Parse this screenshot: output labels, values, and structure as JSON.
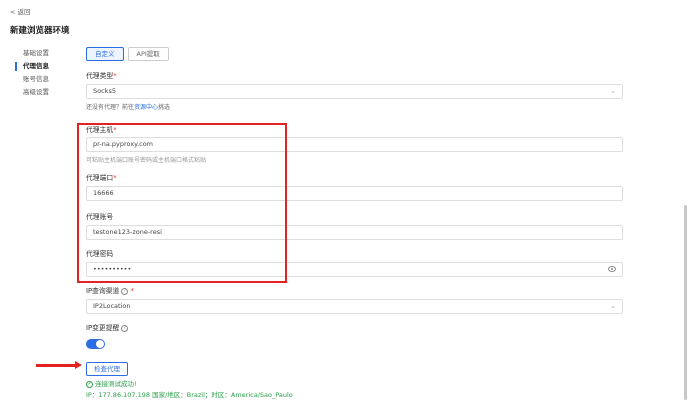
{
  "back": "< 返回",
  "title": "新建浏览器环境",
  "nav": [
    {
      "label": "基础设置"
    },
    {
      "label": "代理信息"
    },
    {
      "label": "账号信息"
    },
    {
      "label": "高级设置"
    }
  ],
  "tabs": {
    "custom": "自定义",
    "api": "API提取"
  },
  "proxy_type": {
    "label": "代理类型",
    "value": "Socks5"
  },
  "no_proxy_hint": {
    "prefix": "还没有代理？前往",
    "link": "资源中心",
    "suffix": "挑选"
  },
  "host": {
    "label": "代理主机",
    "value": "pr-na.pyproxy.com",
    "hint": "可粘贴主机端口账号密码或主机端口格式粘贴"
  },
  "port": {
    "label": "代理端口",
    "value": "16666"
  },
  "account": {
    "label": "代理账号",
    "value": "testone123-zone-resi"
  },
  "password": {
    "label": "代理密码",
    "value": "••••••••••"
  },
  "ip_channel": {
    "label": "IP查询渠道",
    "value": "IP2Location"
  },
  "ip_alert": {
    "label": "IP变更提醒"
  },
  "required_mark": "*",
  "check_button": "检查代理",
  "success_text": "连接测试成功!",
  "ip_info": "IP：177.86.107.198 国家/地区：Brazil；时区：America/Sao_Paulo"
}
